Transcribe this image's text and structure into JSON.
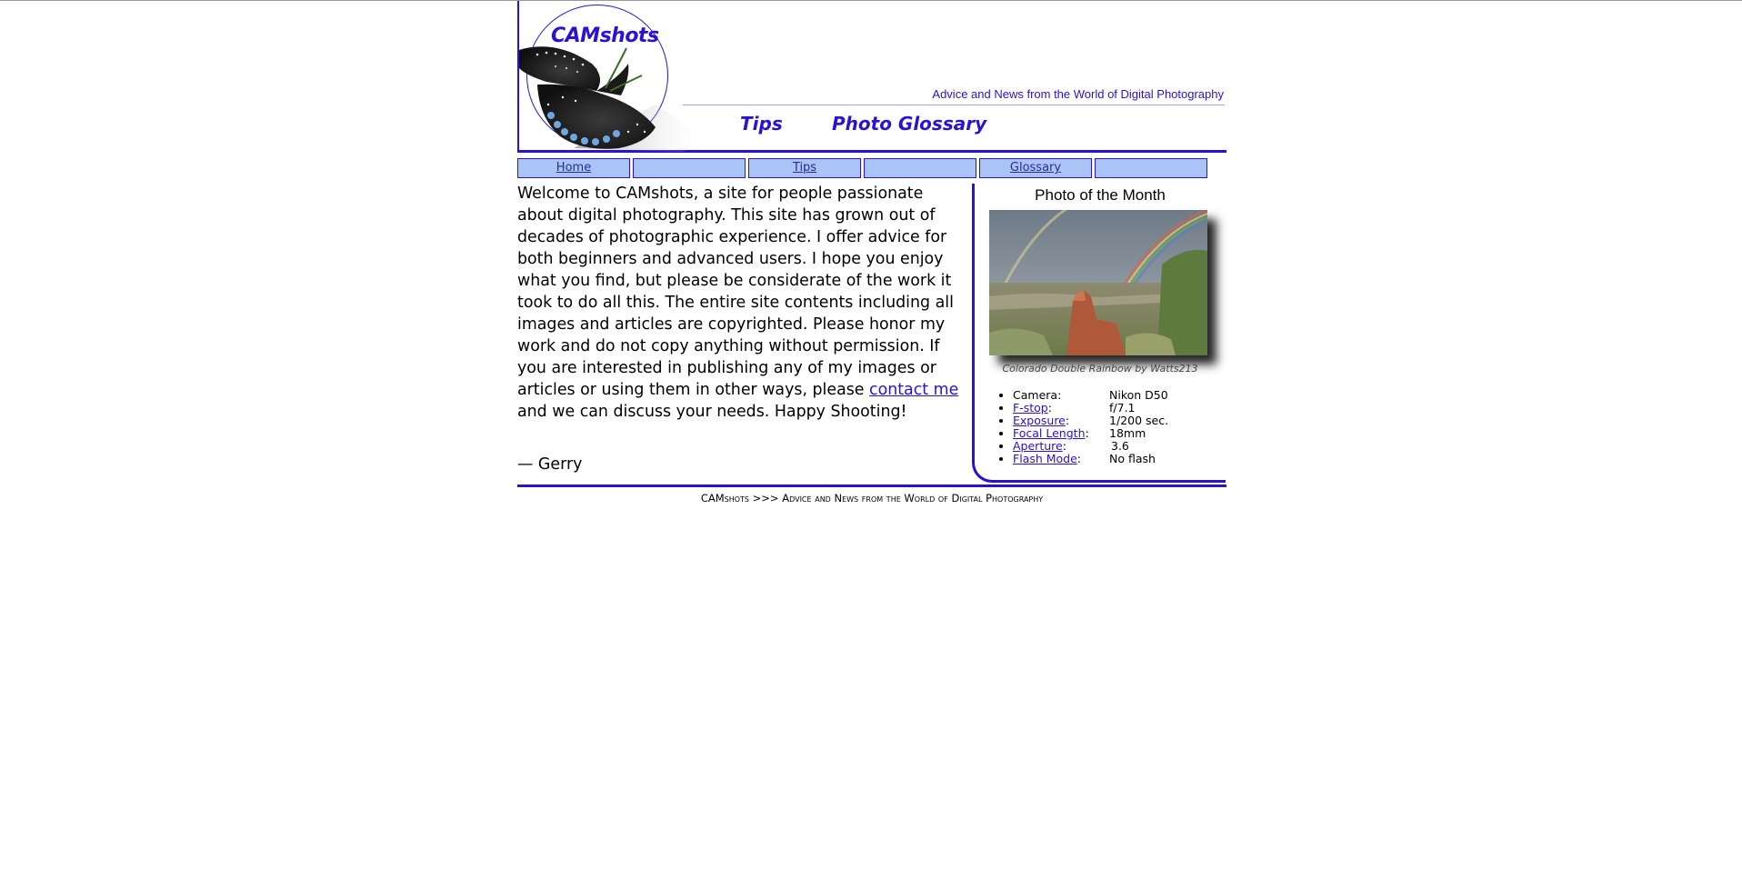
{
  "header": {
    "logo_text": "CAMshots",
    "tagline": "Advice and News from the World of Digital Photography",
    "links": {
      "tips": "Tips",
      "glossary": "Photo Glossary"
    }
  },
  "nav": {
    "items": [
      {
        "label": "Home"
      },
      {
        "label": ""
      },
      {
        "label": "Tips"
      },
      {
        "label": ""
      },
      {
        "label": "Glossary"
      },
      {
        "label": ""
      }
    ]
  },
  "intro": {
    "text_before_link": "Welcome to CAMshots, a site for people passionate about digital photography. This site has grown out of decades of photographic experience. I offer advice for both beginners and advanced users. I hope you enjoy what you find, but please be considerate of the work it took to do all this. The entire site contents including all images and articles are copyrighted. Please honor my work and do not copy anything without permission. If you are interested in publishing any of my images or articles or using them in other ways, please ",
    "link_text": "contact me",
    "text_after_link": " and we can discuss your needs. Happy Shooting!",
    "signature": "— Gerry"
  },
  "sidebar": {
    "title": "Photo of the Month",
    "caption": "Colorado Double Rainbow by Watts213",
    "specs": [
      {
        "label": "Camera",
        "value": "Nikon D50",
        "link": false
      },
      {
        "label": "F-stop",
        "value": "f/7.1",
        "link": true
      },
      {
        "label": "Exposure",
        "value": "1/200 sec.",
        "link": true
      },
      {
        "label": "Focal Length",
        "value": "18mm",
        "link": true
      },
      {
        "label": "Aperture",
        "value": "3.6",
        "link": true
      },
      {
        "label": "Flash Mode",
        "value": "No flash",
        "link": true
      }
    ]
  },
  "footer": {
    "text": "CAMshots >>> Advice and News from the World of Digital Photography"
  },
  "colors": {
    "accent": "#2a12d4",
    "nav_bg": "#a9c4f5"
  }
}
